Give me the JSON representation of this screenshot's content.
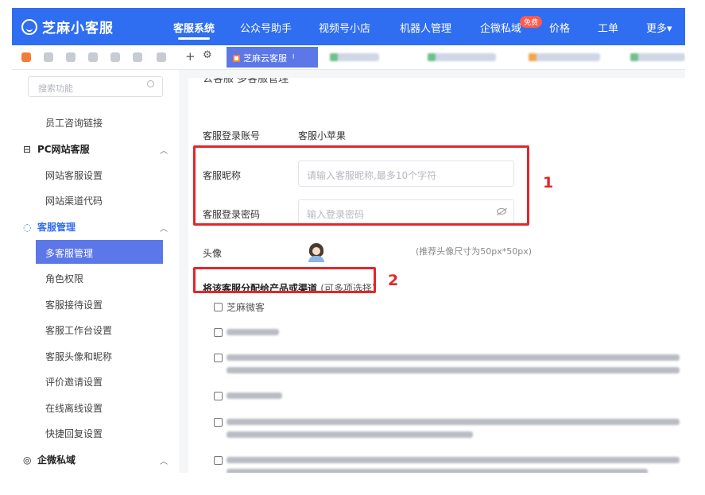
{
  "app": {
    "logo_text": "芝麻小客服"
  },
  "nav": {
    "items": [
      "客服系统",
      "公众号助手",
      "视频号小店",
      "机器人管理",
      "企微私域",
      "价格",
      "工单",
      "更多▾"
    ],
    "free_badge": "免费"
  },
  "tabbar": {
    "active_tab": "芝麻云客服ᅵ"
  },
  "sidebar": {
    "search_placeholder": "搜索功能",
    "items": {
      "employee_link": "员工咨询链接",
      "pc_group": "PC网站客服",
      "site_settings": "网站客服设置",
      "channel_code": "网站渠道代码",
      "agent_group": "客服管理",
      "multi_agent": "多客服管理",
      "roles": "角色权限",
      "reception": "客服接待设置",
      "workbench": "客服工作台设置",
      "avatar_nick": "客服头像和昵称",
      "rating": "评价邀请设置",
      "online": "在线离线设置",
      "quick_reply": "快捷回复设置",
      "wecom_group": "企微私域"
    }
  },
  "content": {
    "title": "公客服 多客服管理",
    "login_account_label": "客服登录账号",
    "login_account_value": "客服小苹果",
    "nickname_label": "客服昵称",
    "nickname_placeholder": "请输入客服昵称,最多10个字符",
    "password_label": "客服登录密码",
    "password_placeholder": "输入登录密码",
    "avatar_label": "头像",
    "avatar_hint": "(推荐头像尺寸为50px*50px)",
    "assign_label": "将该客服分配给产品或渠道",
    "assign_hint": "(可多项选择)",
    "product_first": "芝麻微客"
  },
  "annotations": {
    "box1_number": "1",
    "box2_number": "2"
  },
  "colors": {
    "nav_blue": "#2f6ef0",
    "active_item": "#5b77e8",
    "annotation_red": "#e3262b"
  }
}
